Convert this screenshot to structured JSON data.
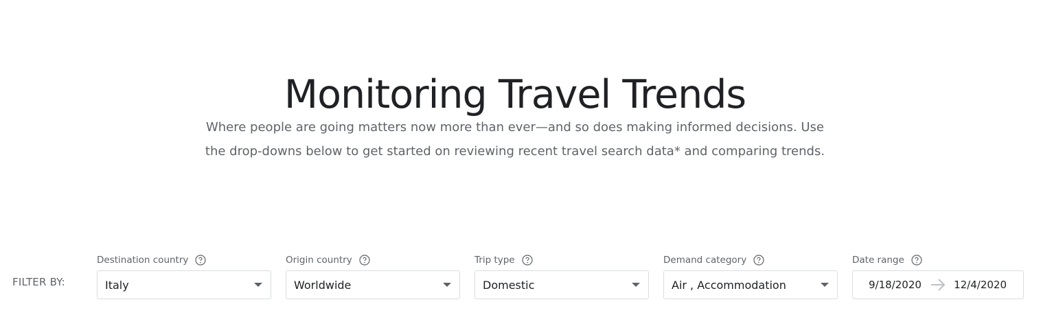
{
  "header": {
    "title": "Monitoring Travel Trends",
    "subtitle": "Where people are going matters now more than ever—and so does making informed decisions. Use the drop-downs below to get started on reviewing recent travel search data* and comparing trends."
  },
  "filters": {
    "label": "FILTER BY:",
    "destination": {
      "label": "Destination country",
      "value": "Italy"
    },
    "origin": {
      "label": "Origin country",
      "value": "Worldwide"
    },
    "trip_type": {
      "label": "Trip type",
      "value": "Domestic"
    },
    "demand": {
      "label": "Demand category",
      "value": "Air , Accommodation"
    },
    "date_range": {
      "label": "Date range",
      "start": "9/18/2020",
      "end": "12/4/2020"
    }
  },
  "icons": {
    "help": "help-circle-icon",
    "dropdown": "caret-down-icon",
    "date_arrow": "arrow-right-icon"
  },
  "colors": {
    "title": "#202124",
    "muted": "#5f6368",
    "border": "#dadce0"
  }
}
